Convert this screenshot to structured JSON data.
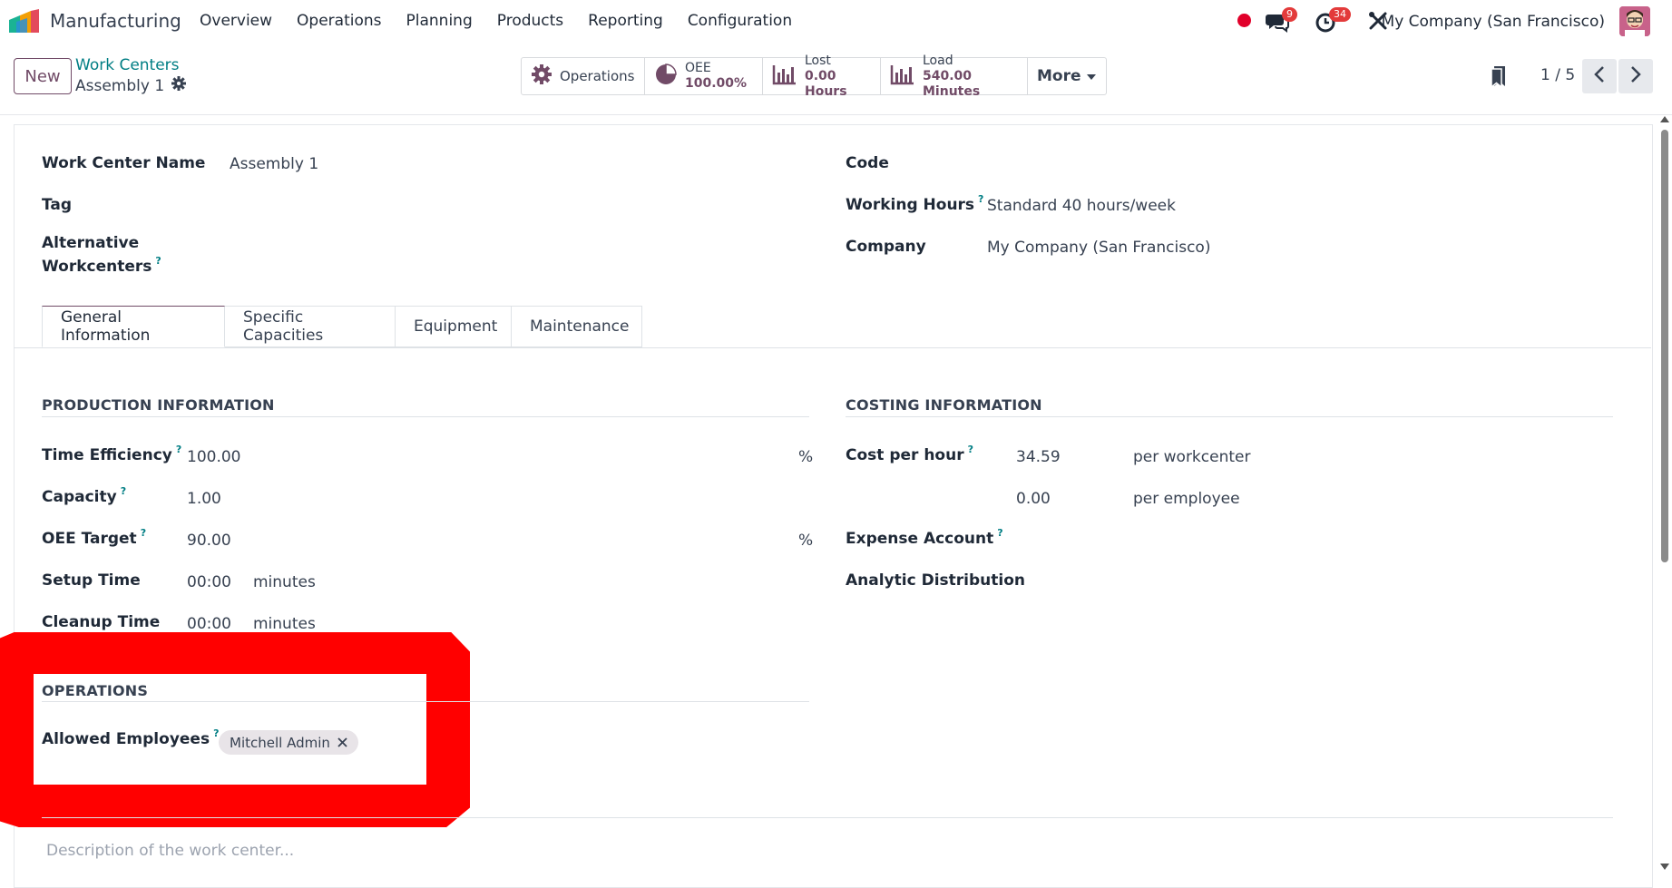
{
  "app": {
    "name": "Manufacturing",
    "logo_icon": "manufacturing-app-icon"
  },
  "menu": [
    "Overview",
    "Operations",
    "Planning",
    "Products",
    "Reporting",
    "Configuration"
  ],
  "systray": {
    "chat_badge": "9",
    "activity_badge": "34",
    "company": "My Company (San Francisco)"
  },
  "control": {
    "new_label": "New",
    "breadcrumb_parent": "Work Centers",
    "breadcrumb_current": "Assembly 1",
    "stats": {
      "operations_label": "Operations",
      "oee_label": "OEE",
      "oee_value": "100.00%",
      "lost_label": "Lost",
      "lost_value": "0.00 Hours",
      "load_label": "Load",
      "load_value": "540.00 Minutes",
      "more_label": "More"
    },
    "pager": "1 / 5"
  },
  "form": {
    "work_center_name_label": "Work Center Name",
    "work_center_name": "Assembly 1",
    "tag_label": "Tag",
    "alt_label_1": "Alternative",
    "alt_label_2": "Workcenters",
    "code_label": "Code",
    "working_hours_label": "Working Hours",
    "working_hours": "Standard 40 hours/week",
    "company_label": "Company",
    "company": "My Company (San Francisco)"
  },
  "tabs": [
    "General Information",
    "Specific Capacities",
    "Equipment",
    "Maintenance"
  ],
  "production": {
    "title": "PRODUCTION INFORMATION",
    "time_efficiency_label": "Time Efficiency",
    "time_efficiency": "100.00",
    "pct": "%",
    "capacity_label": "Capacity",
    "capacity": "1.00",
    "oee_target_label": "OEE Target",
    "oee_target": "90.00",
    "setup_time_label": "Setup Time",
    "setup_time": "00:00",
    "cleanup_time_label": "Cleanup Time",
    "cleanup_time": "00:00",
    "minutes": "minutes"
  },
  "costing": {
    "title": "COSTING INFORMATION",
    "cost_per_hour_label": "Cost per hour",
    "cost_per_hour": "34.59",
    "per_workcenter": "per workcenter",
    "employee_cost": "0.00",
    "per_employee": "per employee",
    "expense_account_label": "Expense Account",
    "analytic_label": "Analytic Distribution"
  },
  "operations": {
    "title": "OPERATIONS",
    "allowed_employees_label": "Allowed Employees",
    "employee_tag": "Mitchell Admin"
  },
  "description_placeholder": "Description of the work center...",
  "help_mark": "?",
  "colors": {
    "brand": "#714b67",
    "link": "#017e84",
    "highlight": "#ff0000"
  }
}
